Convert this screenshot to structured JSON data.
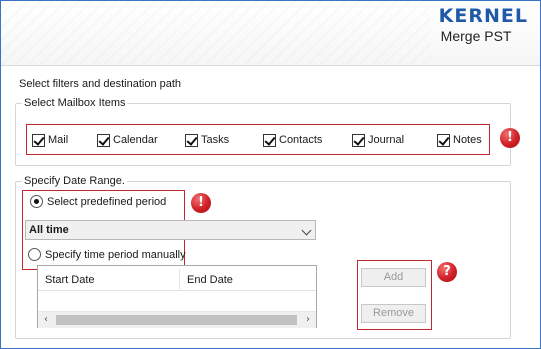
{
  "brand": {
    "logo": "KERNEL",
    "product": "Merge PST"
  },
  "instruction": "Select filters and destination path",
  "mailbox_group": {
    "title": "Select Mailbox Items",
    "items": [
      {
        "label": "Mail",
        "checked": true
      },
      {
        "label": "Calendar",
        "checked": true
      },
      {
        "label": "Tasks",
        "checked": true
      },
      {
        "label": "Contacts",
        "checked": true
      },
      {
        "label": "Journal",
        "checked": true
      },
      {
        "label": "Notes",
        "checked": true
      }
    ]
  },
  "date_group": {
    "title": "Specify Date Range.",
    "radio_predefined": "Select predefined period",
    "radio_manual": "Specify time period manually",
    "period_select": {
      "value": "All time"
    },
    "grid": {
      "columns": [
        "Start Date",
        "End Date"
      ],
      "rows": []
    },
    "add_label": "Add",
    "remove_label": "Remove"
  },
  "badges": {
    "alert": "!",
    "help": "?"
  },
  "colors": {
    "accent": "#1e5aa8",
    "highlight": "#c0282f"
  }
}
